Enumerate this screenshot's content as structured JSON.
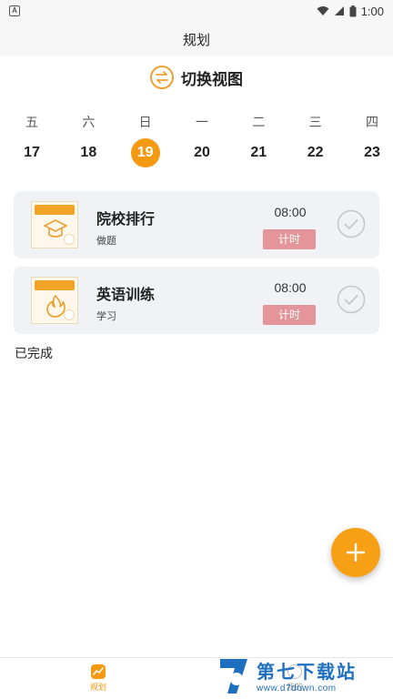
{
  "status_bar": {
    "time": "1:00",
    "app_icon_letter": "A"
  },
  "header": {
    "title": "规划"
  },
  "switch_view": {
    "label": "切换视图",
    "icon": "swap-arrows-icon"
  },
  "calendar": {
    "weekdays": [
      "五",
      "六",
      "日",
      "一",
      "二",
      "三",
      "四"
    ],
    "dates": [
      "17",
      "18",
      "19",
      "20",
      "21",
      "22",
      "23"
    ],
    "selected": "19",
    "accent": "#f39a12"
  },
  "tasks": [
    {
      "title": "院校排行",
      "subtitle": "做题",
      "time": "08:00",
      "timer_label": "计时",
      "thumb_icon": "graduation-cap-icon"
    },
    {
      "title": "英语训练",
      "subtitle": "学习",
      "time": "08:00",
      "timer_label": "计时",
      "thumb_icon": "flame-icon"
    }
  ],
  "completed_section": {
    "label": "已完成"
  },
  "fab": {
    "icon": "plus-icon",
    "color": "#f7a016"
  },
  "tabbar": {
    "tabs": [
      {
        "label": "规划",
        "icon": "chart-icon",
        "active": true
      },
      {
        "label": "我的",
        "icon": "profile-icon",
        "active": false
      }
    ]
  },
  "watermark": {
    "main": "第七下载站",
    "url": "www.d7down.com"
  }
}
